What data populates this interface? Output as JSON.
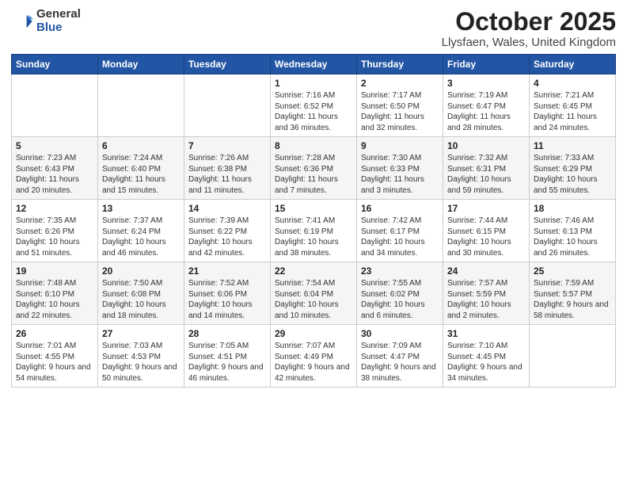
{
  "header": {
    "logo_general": "General",
    "logo_blue": "Blue",
    "month_title": "October 2025",
    "location": "Llysfaen, Wales, United Kingdom"
  },
  "weekdays": [
    "Sunday",
    "Monday",
    "Tuesday",
    "Wednesday",
    "Thursday",
    "Friday",
    "Saturday"
  ],
  "weeks": [
    [
      {
        "day": "",
        "content": ""
      },
      {
        "day": "",
        "content": ""
      },
      {
        "day": "",
        "content": ""
      },
      {
        "day": "1",
        "content": "Sunrise: 7:16 AM\nSunset: 6:52 PM\nDaylight: 11 hours\nand 36 minutes."
      },
      {
        "day": "2",
        "content": "Sunrise: 7:17 AM\nSunset: 6:50 PM\nDaylight: 11 hours\nand 32 minutes."
      },
      {
        "day": "3",
        "content": "Sunrise: 7:19 AM\nSunset: 6:47 PM\nDaylight: 11 hours\nand 28 minutes."
      },
      {
        "day": "4",
        "content": "Sunrise: 7:21 AM\nSunset: 6:45 PM\nDaylight: 11 hours\nand 24 minutes."
      }
    ],
    [
      {
        "day": "5",
        "content": "Sunrise: 7:23 AM\nSunset: 6:43 PM\nDaylight: 11 hours\nand 20 minutes."
      },
      {
        "day": "6",
        "content": "Sunrise: 7:24 AM\nSunset: 6:40 PM\nDaylight: 11 hours\nand 15 minutes."
      },
      {
        "day": "7",
        "content": "Sunrise: 7:26 AM\nSunset: 6:38 PM\nDaylight: 11 hours\nand 11 minutes."
      },
      {
        "day": "8",
        "content": "Sunrise: 7:28 AM\nSunset: 6:36 PM\nDaylight: 11 hours\nand 7 minutes."
      },
      {
        "day": "9",
        "content": "Sunrise: 7:30 AM\nSunset: 6:33 PM\nDaylight: 11 hours\nand 3 minutes."
      },
      {
        "day": "10",
        "content": "Sunrise: 7:32 AM\nSunset: 6:31 PM\nDaylight: 10 hours\nand 59 minutes."
      },
      {
        "day": "11",
        "content": "Sunrise: 7:33 AM\nSunset: 6:29 PM\nDaylight: 10 hours\nand 55 minutes."
      }
    ],
    [
      {
        "day": "12",
        "content": "Sunrise: 7:35 AM\nSunset: 6:26 PM\nDaylight: 10 hours\nand 51 minutes."
      },
      {
        "day": "13",
        "content": "Sunrise: 7:37 AM\nSunset: 6:24 PM\nDaylight: 10 hours\nand 46 minutes."
      },
      {
        "day": "14",
        "content": "Sunrise: 7:39 AM\nSunset: 6:22 PM\nDaylight: 10 hours\nand 42 minutes."
      },
      {
        "day": "15",
        "content": "Sunrise: 7:41 AM\nSunset: 6:19 PM\nDaylight: 10 hours\nand 38 minutes."
      },
      {
        "day": "16",
        "content": "Sunrise: 7:42 AM\nSunset: 6:17 PM\nDaylight: 10 hours\nand 34 minutes."
      },
      {
        "day": "17",
        "content": "Sunrise: 7:44 AM\nSunset: 6:15 PM\nDaylight: 10 hours\nand 30 minutes."
      },
      {
        "day": "18",
        "content": "Sunrise: 7:46 AM\nSunset: 6:13 PM\nDaylight: 10 hours\nand 26 minutes."
      }
    ],
    [
      {
        "day": "19",
        "content": "Sunrise: 7:48 AM\nSunset: 6:10 PM\nDaylight: 10 hours\nand 22 minutes."
      },
      {
        "day": "20",
        "content": "Sunrise: 7:50 AM\nSunset: 6:08 PM\nDaylight: 10 hours\nand 18 minutes."
      },
      {
        "day": "21",
        "content": "Sunrise: 7:52 AM\nSunset: 6:06 PM\nDaylight: 10 hours\nand 14 minutes."
      },
      {
        "day": "22",
        "content": "Sunrise: 7:54 AM\nSunset: 6:04 PM\nDaylight: 10 hours\nand 10 minutes."
      },
      {
        "day": "23",
        "content": "Sunrise: 7:55 AM\nSunset: 6:02 PM\nDaylight: 10 hours\nand 6 minutes."
      },
      {
        "day": "24",
        "content": "Sunrise: 7:57 AM\nSunset: 5:59 PM\nDaylight: 10 hours\nand 2 minutes."
      },
      {
        "day": "25",
        "content": "Sunrise: 7:59 AM\nSunset: 5:57 PM\nDaylight: 9 hours\nand 58 minutes."
      }
    ],
    [
      {
        "day": "26",
        "content": "Sunrise: 7:01 AM\nSunset: 4:55 PM\nDaylight: 9 hours\nand 54 minutes."
      },
      {
        "day": "27",
        "content": "Sunrise: 7:03 AM\nSunset: 4:53 PM\nDaylight: 9 hours\nand 50 minutes."
      },
      {
        "day": "28",
        "content": "Sunrise: 7:05 AM\nSunset: 4:51 PM\nDaylight: 9 hours\nand 46 minutes."
      },
      {
        "day": "29",
        "content": "Sunrise: 7:07 AM\nSunset: 4:49 PM\nDaylight: 9 hours\nand 42 minutes."
      },
      {
        "day": "30",
        "content": "Sunrise: 7:09 AM\nSunset: 4:47 PM\nDaylight: 9 hours\nand 38 minutes."
      },
      {
        "day": "31",
        "content": "Sunrise: 7:10 AM\nSunset: 4:45 PM\nDaylight: 9 hours\nand 34 minutes."
      },
      {
        "day": "",
        "content": ""
      }
    ]
  ]
}
